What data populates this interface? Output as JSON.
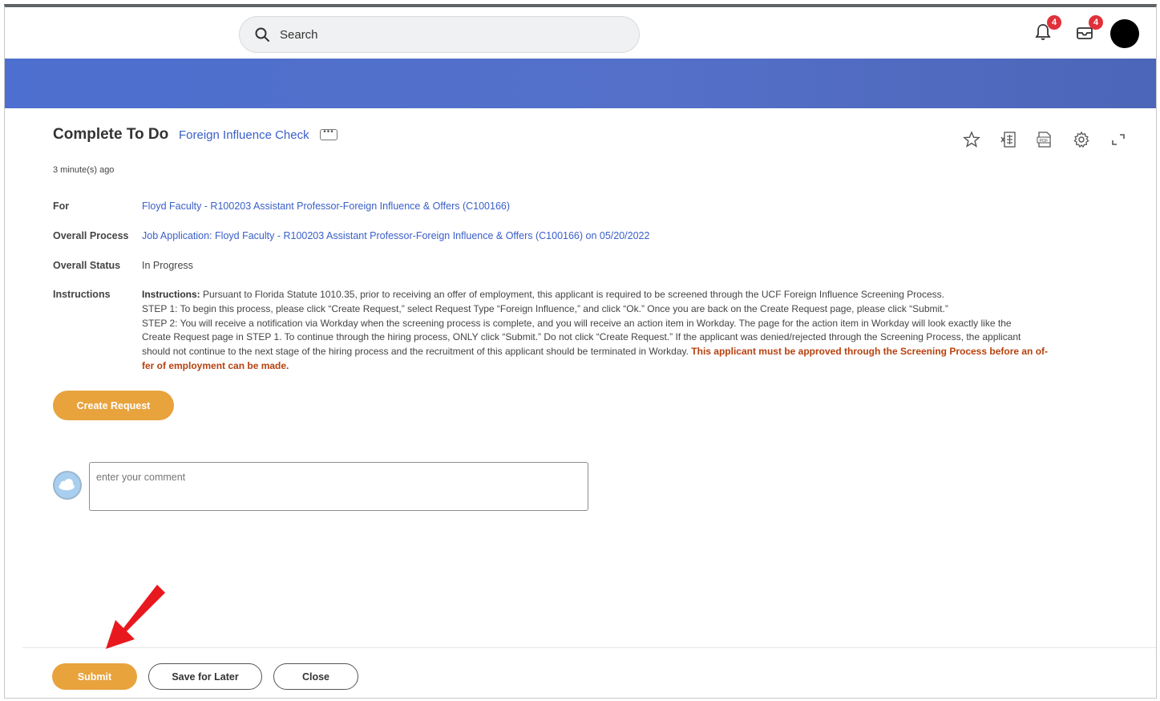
{
  "header": {
    "search_label": "Search",
    "notifications_count": "4",
    "inbox_count": "4"
  },
  "page": {
    "title": "Complete To Do",
    "subtitle": "Foreign Influence Check",
    "more_label": "•••",
    "timestamp": "3 minute(s) ago"
  },
  "fields": {
    "for_label": "For",
    "for_value": "Floyd Faculty - R100203 Assistant Professor-Foreign Influence & Offers (C100166)",
    "process_label": "Overall Process",
    "process_value": "Job Application: Floyd Faculty - R100203 Assistant Professor-Foreign Influence & Offers (C100166) on 05/20/2022",
    "status_label": "Overall Status",
    "status_value": "In Progress",
    "instructions_label": "Instructions"
  },
  "instructions": {
    "lead": "Instructions:",
    "line1": " Pursuant to Florida Statute 1010.35, prior to receiving an offer of employment, this applicant is required to be screened through the UCF Foreign Influence Screening Process.",
    "line2": "STEP 1: To begin this process, please click “Create Request,” select Request Type “Foreign Influence,” and click “Ok.” Once you are back on the Create Request page, please click “Submit.”",
    "line3": "STEP 2: You will receive a notification via Workday when the screening process is complete, and you will receive an action item in Workday. The page for the action item in Workday will look exactly like the",
    "line4": "Create Request page in STEP 1. To continue through the hiring process, ONLY click “Submit.” Do not click “Create Request.” If the applicant was denied/rejected through the Screening Process, the applicant",
    "line5": "should not continue to the next stage of the hiring process and the recruitment of this applicant should be terminated in Workday. ",
    "warning_a": "This applicant must be approved through the Screening Process before an of-",
    "warning_b": "fer of employment can be made."
  },
  "actions": {
    "create_request": "Create Request",
    "comment_placeholder": "enter your comment",
    "submit": "Submit",
    "save_for_later": "Save for Later",
    "close": "Close"
  },
  "colors": {
    "accent_orange": "#e8a33d",
    "link_blue": "#3a5fc8",
    "banner_blue": "#5470c9",
    "warning_red": "#b7410e",
    "badge_red": "#e0303a",
    "annotation_arrow": "#e8191e"
  },
  "icons": [
    "search-icon",
    "bell-icon",
    "inbox-icon",
    "star-icon",
    "excel-icon",
    "pdf-icon",
    "gear-icon",
    "expand-icon",
    "cloud-icon",
    "red-arrow"
  ]
}
